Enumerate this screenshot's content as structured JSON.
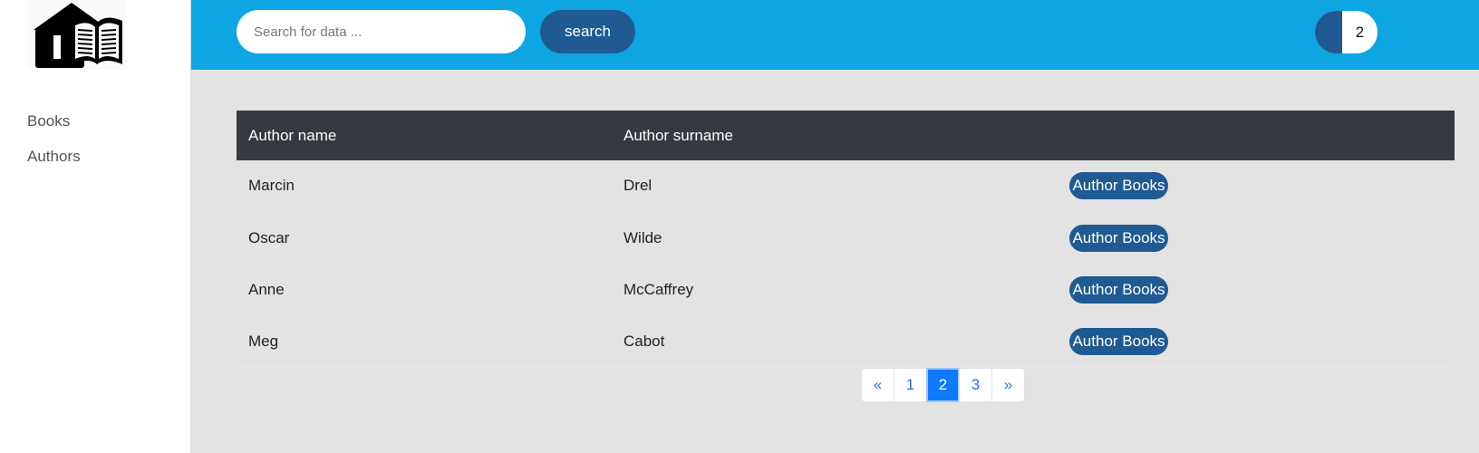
{
  "sidebar": {
    "logo_alt": "library logo",
    "items": [
      {
        "label": "Books"
      },
      {
        "label": "Authors"
      }
    ]
  },
  "header": {
    "search_placeholder": "Search for data ...",
    "search_button": "search",
    "cart_count": "2"
  },
  "table": {
    "headers": [
      "Author name",
      "Author surname",
      ""
    ],
    "rows": [
      {
        "name": "Marcin",
        "surname": "Drel",
        "action": "Author Books"
      },
      {
        "name": "Oscar",
        "surname": "Wilde",
        "action": "Author Books"
      },
      {
        "name": "Anne",
        "surname": "McCaffrey",
        "action": "Author Books"
      },
      {
        "name": "Meg",
        "surname": "Cabot",
        "action": "Author Books"
      }
    ]
  },
  "pagination": {
    "prev": "«",
    "pages": [
      "1",
      "2",
      "3"
    ],
    "active": "2",
    "next": "»"
  },
  "colors": {
    "topbar": "#0ea5e3",
    "primary": "#1f5a92",
    "table_header": "#353a41",
    "active_page": "#0d7bfb"
  }
}
